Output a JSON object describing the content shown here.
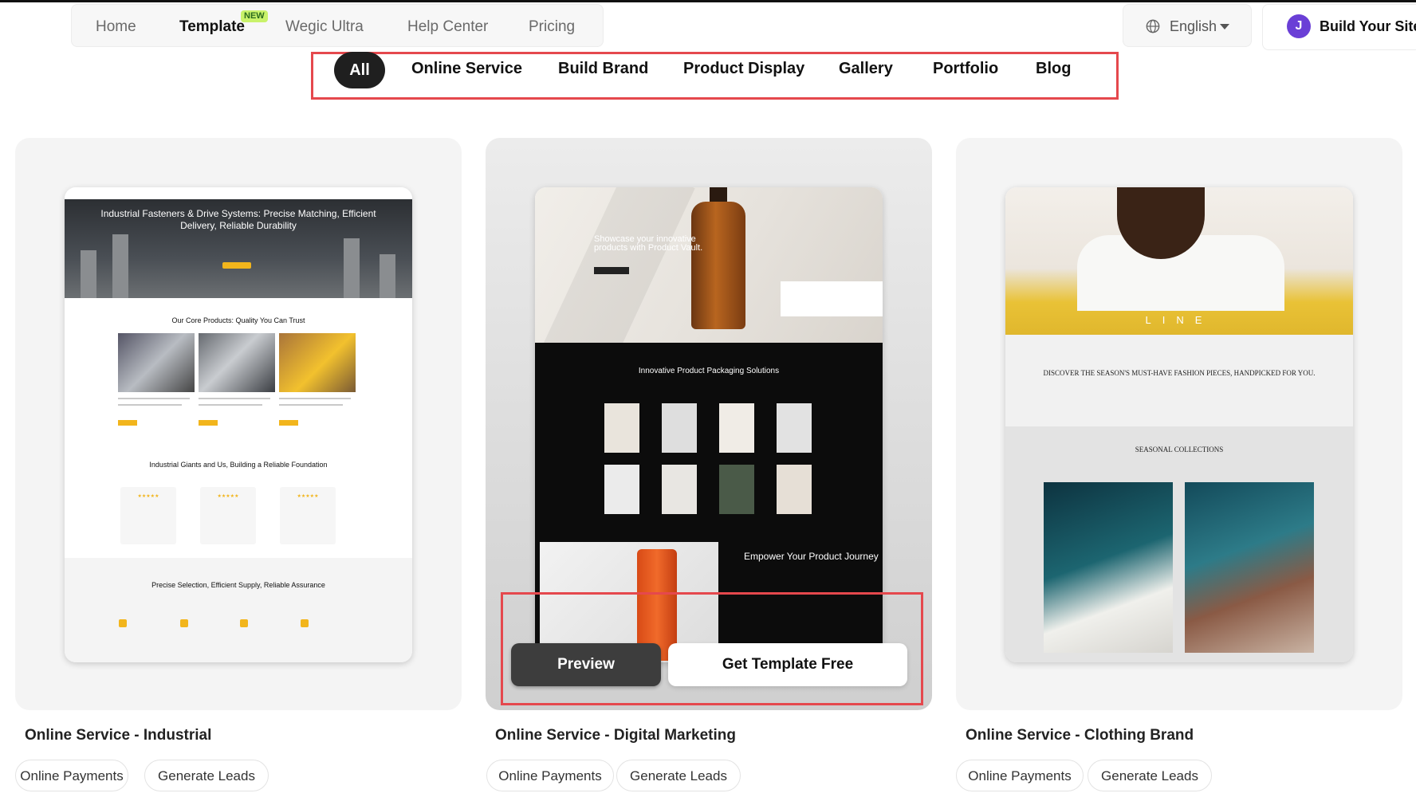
{
  "nav": {
    "items": [
      {
        "label": "Home"
      },
      {
        "label": "Template",
        "badge": "NEW",
        "active": true
      },
      {
        "label": "Wegic Ultra"
      },
      {
        "label": "Help Center"
      },
      {
        "label": "Pricing"
      }
    ]
  },
  "language": {
    "label": "English",
    "icon": "globe-icon"
  },
  "build_site": {
    "avatar_initial": "J",
    "label": "Build Your Site",
    "avatar_color": "#6a3fd6"
  },
  "filters": {
    "items": [
      {
        "label": "All",
        "active": true
      },
      {
        "label": "Online Service"
      },
      {
        "label": "Build Brand"
      },
      {
        "label": "Product Display"
      },
      {
        "label": "Gallery"
      },
      {
        "label": "Portfolio"
      },
      {
        "label": "Blog"
      }
    ]
  },
  "cards": [
    {
      "title": "Online Service - Industrial",
      "tags": [
        "Online Payments",
        "Generate Leads"
      ],
      "preview": {
        "hero_title": "Industrial Fasteners & Drive Systems: Precise Matching, Efficient Delivery, Reliable Durability",
        "section1": "Our Core Products: Quality You Can Trust",
        "section2": "Industrial Giants and Us, Building a Reliable Foundation",
        "section3": "Precise Selection, Efficient Supply, Reliable Assurance"
      }
    },
    {
      "title": "Online Service - Digital Marketing",
      "tags": [
        "Online Payments",
        "Generate Leads"
      ],
      "preview": {
        "hero_text": "Showcase your innovative products with Product Vault.",
        "section1": "Innovative Product Packaging Solutions",
        "section2": "Empower Your Product Journey"
      },
      "buttons": {
        "preview": "Preview",
        "get": "Get Template Free"
      }
    },
    {
      "title": "Online Service - Clothing Brand",
      "tags": [
        "Online Payments",
        "Generate Leads"
      ],
      "preview": {
        "hero_word": "LINE",
        "headline": "DISCOVER THE SEASON'S MUST-HAVE FASHION PIECES, HANDPICKED FOR YOU.",
        "section1": "SEASONAL COLLECTIONS"
      }
    }
  ],
  "colors": {
    "highlight": "#e5484d",
    "accent_yellow": "#f2b51c",
    "new_badge": "#c9f26a"
  }
}
